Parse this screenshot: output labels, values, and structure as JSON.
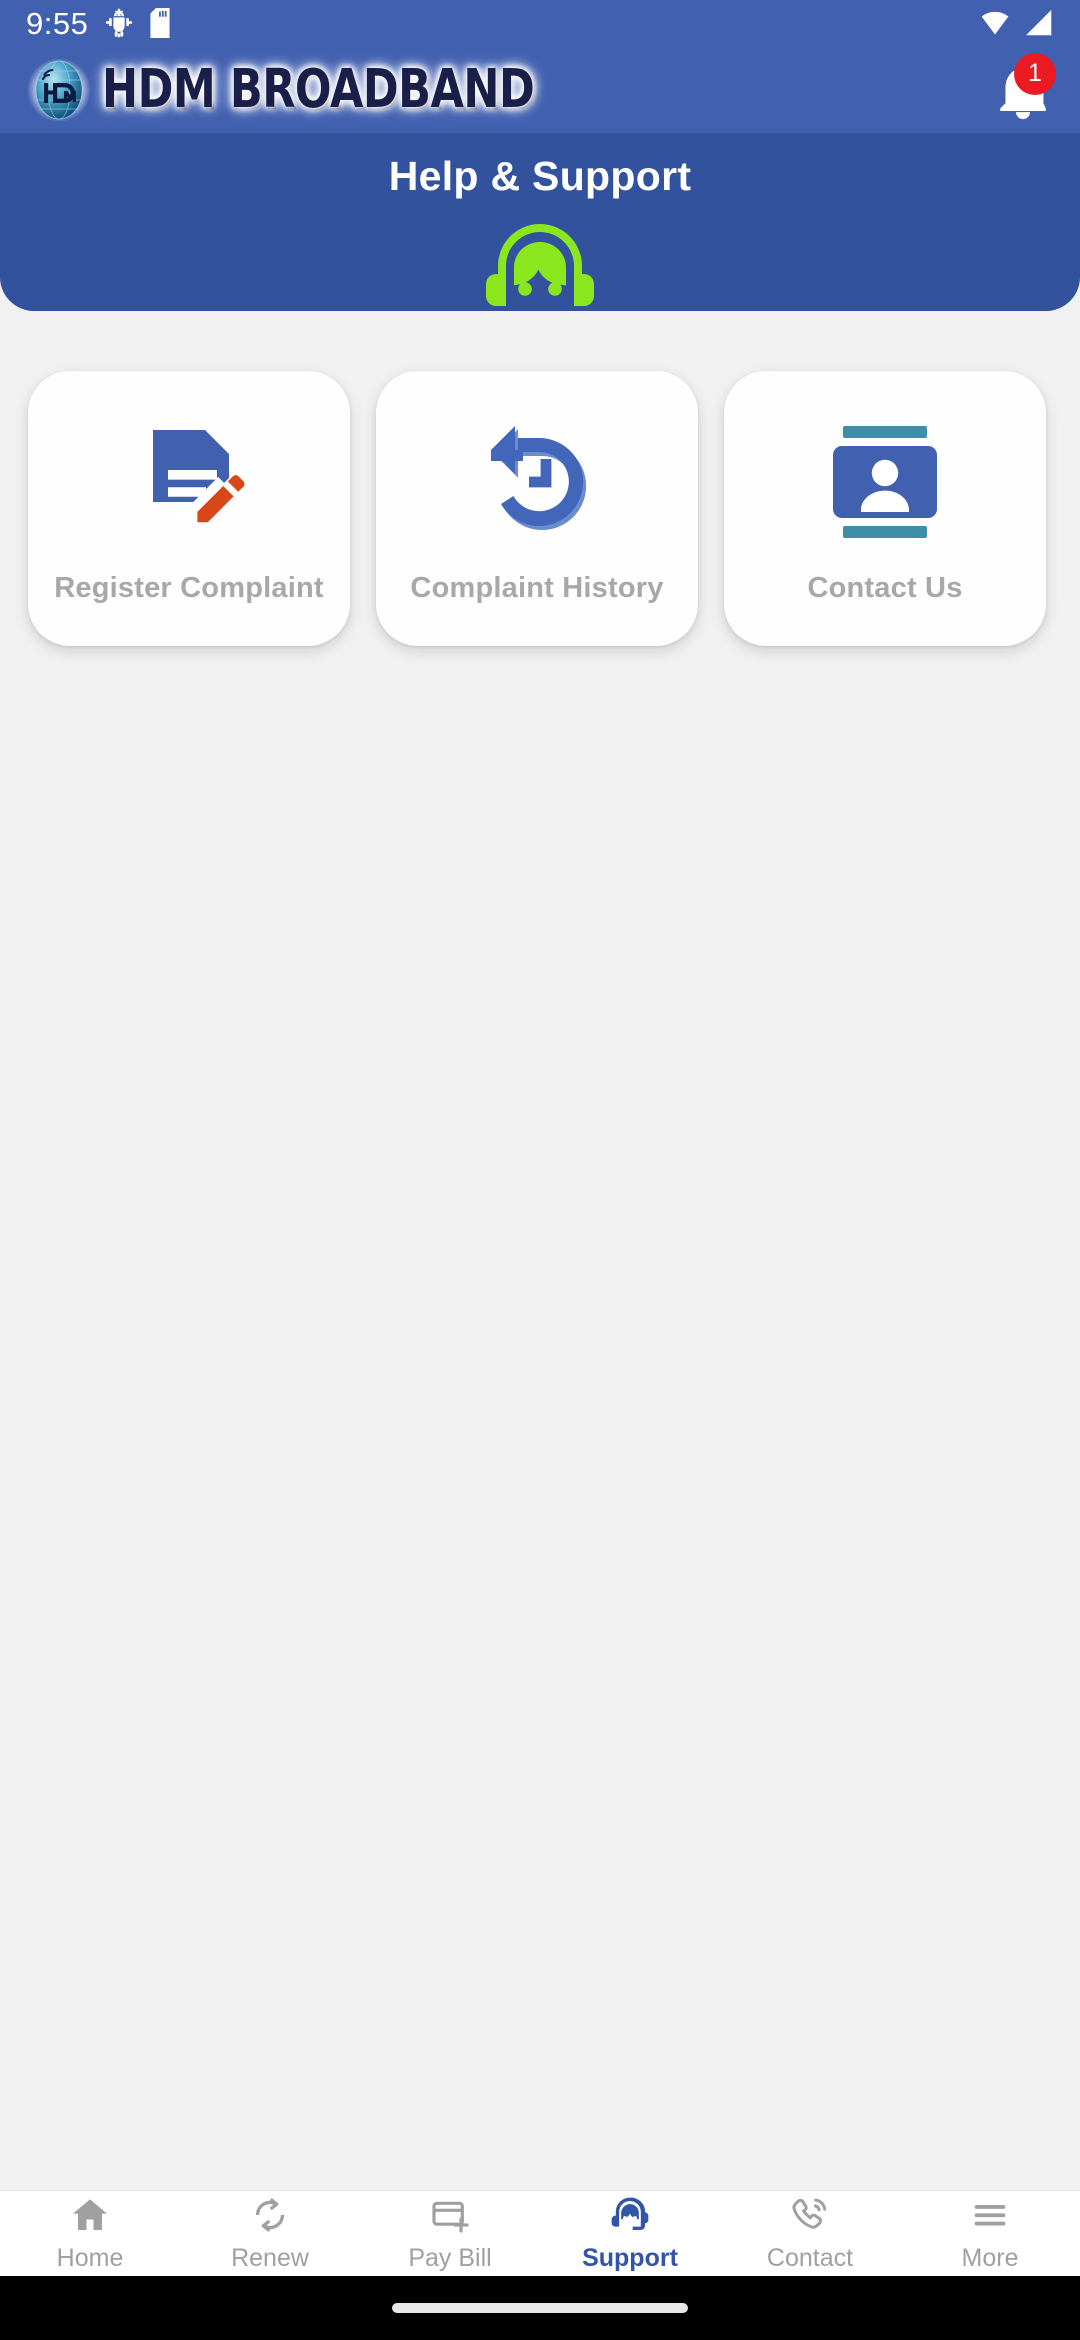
{
  "status_bar": {
    "time": "9:55",
    "left_icons": [
      "android-debug-icon",
      "sd-card-icon"
    ],
    "right_icons": [
      "wifi-icon",
      "cellular-signal-icon"
    ]
  },
  "app_bar": {
    "brand_name": "HDM BROADBAND",
    "logo_icon": "hdm-globe-logo-icon",
    "notification": {
      "icon": "bell-icon",
      "badge_count": "1",
      "badge_color": "#ec1b23"
    },
    "background_color": "#4160b0"
  },
  "hero": {
    "title": "Help & Support",
    "icon": "support-headset-agent-icon",
    "icon_color": "#8ae61d",
    "background_color": "#32529d"
  },
  "cards": [
    {
      "label": "Register Complaint",
      "icon": "document-edit-pencil-icon",
      "icon_colors": {
        "primary": "#4160b0",
        "accent": "#d8471a"
      }
    },
    {
      "label": "Complaint History",
      "icon": "history-restore-clock-icon",
      "icon_colors": {
        "primary": "#4166ba",
        "accent": "#6b8ccd"
      }
    },
    {
      "label": "Contact Us",
      "icon": "contact-card-person-icon",
      "icon_colors": {
        "primary": "#4160b0",
        "accent": "#3d8ea6"
      }
    }
  ],
  "bottom_nav": {
    "active_index": 3,
    "active_color": "#3355a8",
    "inactive_color": "#a0a0a0",
    "items": [
      {
        "label": "Home",
        "icon": "home-icon"
      },
      {
        "label": "Renew",
        "icon": "refresh-sync-icon"
      },
      {
        "label": "Pay Bill",
        "icon": "card-plus-icon"
      },
      {
        "label": "Support",
        "icon": "headset-support-icon"
      },
      {
        "label": "Contact",
        "icon": "phone-ring-icon"
      },
      {
        "label": "More",
        "icon": "hamburger-menu-icon"
      }
    ]
  }
}
